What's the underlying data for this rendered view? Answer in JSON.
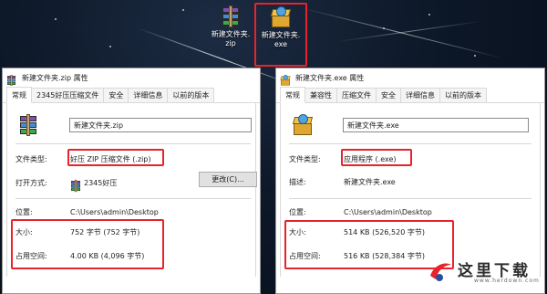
{
  "desktop": {
    "icons": [
      {
        "name": "新建文件夹.\nzip",
        "type": "zip"
      },
      {
        "name": "新建文件夹.\nexe",
        "type": "exe",
        "selected": true
      }
    ]
  },
  "left_window": {
    "title": "新建文件夹.zip 属性",
    "tabs": [
      "常规",
      "2345好压压缩文件",
      "安全",
      "详细信息",
      "以前的版本"
    ],
    "file_name": "新建文件夹.zip",
    "type_label": "文件类型:",
    "type_value": "好压 ZIP 压缩文件 (.zip)",
    "open_label": "打开方式:",
    "open_value": "2345好压",
    "change_button": "更改(C)...",
    "location_label": "位置:",
    "location_value": "C:\\Users\\admin\\Desktop",
    "size_label": "大小:",
    "size_value": "752 字节 (752 字节)",
    "disk_label": "占用空间:",
    "disk_value": "4.00 KB (4,096 字节)"
  },
  "right_window": {
    "title": "新建文件夹.exe 属性",
    "tabs": [
      "常规",
      "兼容性",
      "压缩文件",
      "安全",
      "详细信息",
      "以前的版本"
    ],
    "file_name": "新建文件夹.exe",
    "type_label": "文件类型:",
    "type_value": "应用程序 (.exe)",
    "desc_label": "描述:",
    "desc_value": "新建文件夹.exe",
    "location_label": "位置:",
    "location_value": "C:\\Users\\admin\\Desktop",
    "size_label": "大小:",
    "size_value": "514 KB (526,520 字节)",
    "disk_label": "占用空间:",
    "disk_value": "516 KB (528,384 字节)"
  },
  "watermark": {
    "text": "这里下载",
    "url": "www.herdown.com"
  },
  "colors": {
    "highlight": "#e8232a",
    "desktop_bg": "#0d1828"
  }
}
